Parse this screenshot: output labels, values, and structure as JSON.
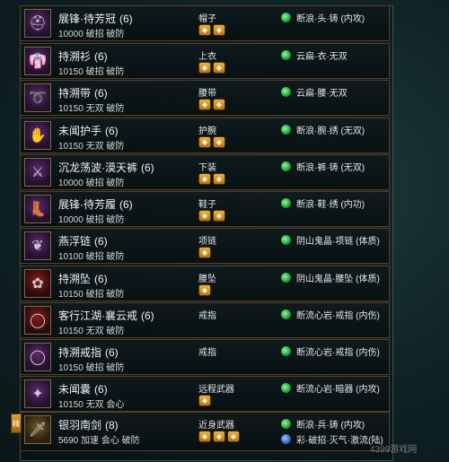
{
  "rows": [
    {
      "name": "展锋·待芳冠",
      "count": "(6)",
      "stats": "10000 破招 破防",
      "slot": "帽子",
      "gems": [
        "gold",
        "gold"
      ],
      "set": "断浪·头·铸 (内攻)",
      "set_dot": "green",
      "icon": "helmet-icon",
      "thumb": "purple"
    },
    {
      "name": "持溯衫",
      "count": "(6)",
      "stats": "10150 破招 破防",
      "slot": "上衣",
      "gems": [
        "gold",
        "gold"
      ],
      "set": "云扁·衣·无双",
      "set_dot": "green",
      "icon": "robe-icon",
      "thumb": "purple"
    },
    {
      "name": "持溯带",
      "count": "(6)",
      "stats": "10150 无双 破防",
      "slot": "腰带",
      "gems": [
        "gold",
        "gold"
      ],
      "set": "云扁·腰·无双",
      "set_dot": "green",
      "icon": "belt-icon",
      "thumb": "purple"
    },
    {
      "name": "未闻护手",
      "count": "(6)",
      "stats": "10150 无双 破防",
      "slot": "护腕",
      "gems": [
        "gold",
        "gold"
      ],
      "set": "断浪·腕·绣 (无双)",
      "set_dot": "green",
      "icon": "bracer-icon",
      "thumb": "purple"
    },
    {
      "name": "沉龙荡波·漠天裤",
      "count": "(6)",
      "stats": "10000 破招 破防",
      "slot": "下装",
      "gems": [
        "gold",
        "gold"
      ],
      "set": "断浪·裤·铸 (无双)",
      "set_dot": "green",
      "icon": "pants-icon",
      "thumb": "purple"
    },
    {
      "name": "展锋·待芳履",
      "count": "(6)",
      "stats": "10000 破招 破防",
      "slot": "鞋子",
      "gems": [
        "gold",
        "gold"
      ],
      "set": "断浪·鞋·绣 (内功)",
      "set_dot": "green",
      "icon": "boots-icon",
      "thumb": "purple"
    },
    {
      "name": "燕浮链",
      "count": "(6)",
      "stats": "10100 破招 破防",
      "slot": "项链",
      "gems": [
        "gold"
      ],
      "set": "阴山鬼晶·项链 (体质)",
      "set_dot": "green",
      "icon": "necklace-icon",
      "thumb": "purple"
    },
    {
      "name": "持溯坠",
      "count": "(6)",
      "stats": "10150 破招 破防",
      "slot": "腰坠",
      "gems": [
        "gold"
      ],
      "set": "阴山鬼晶·腰坠 (体质)",
      "set_dot": "green",
      "icon": "pendant-icon",
      "thumb": "red"
    },
    {
      "name": "客行江湖·襄云戒",
      "count": "(6)",
      "stats": "10150 无双 破防",
      "slot": "戒指",
      "gems": [],
      "set": "断流心岩·戒指 (内伤)",
      "set_dot": "green",
      "icon": "ring-icon",
      "thumb": "red"
    },
    {
      "name": "持溯戒指",
      "count": "(6)",
      "stats": "10150 破招 破防",
      "slot": "戒指",
      "gems": [],
      "set": "断流心岩·戒指 (内伤)",
      "set_dot": "green",
      "icon": "ring-icon",
      "thumb": "purple"
    },
    {
      "name": "未闻囊",
      "count": "(6)",
      "stats": "10150 无双 会心",
      "slot": "远程武器",
      "gems": [
        "gold"
      ],
      "set": "断流心岩·暗器 (内攻)",
      "set_dot": "green",
      "icon": "pouch-icon",
      "thumb": "purple"
    },
    {
      "name": "银羽南剑",
      "count": "(8)",
      "stats": "5690 加速 会心 破防",
      "slot": "近身武器",
      "gems": [
        "gold",
        "gold",
        "gold"
      ],
      "set": "断浪·兵·铸 (内攻)",
      "set_dot": "green",
      "set2": "彩·破招·灭气·激流(陆)",
      "set2_dot": "blue",
      "icon": "sword-icon",
      "thumb": "gold"
    }
  ],
  "side_badge": "精",
  "watermark": "4399游戏网"
}
